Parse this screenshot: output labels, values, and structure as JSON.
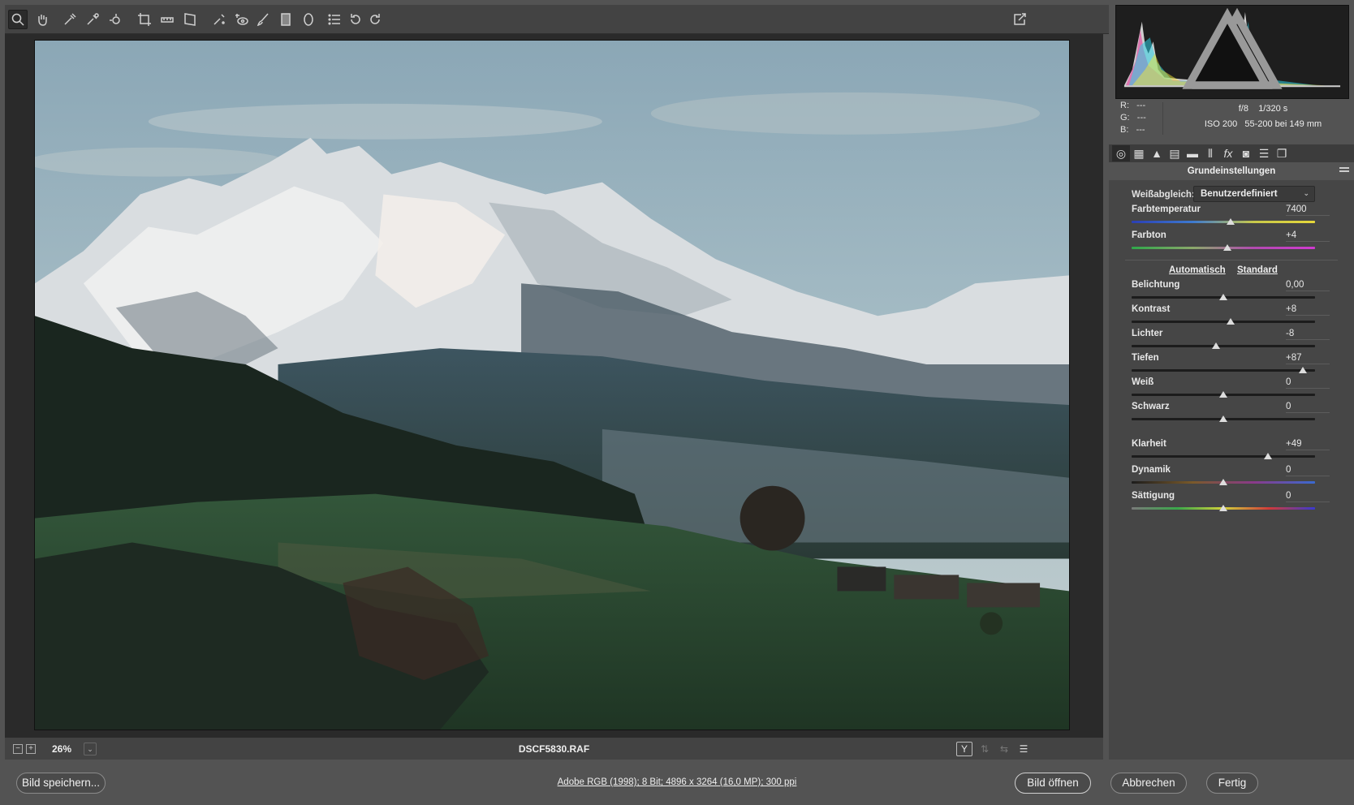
{
  "toolbar": {
    "tools": [
      "zoom-tool",
      "hand-tool",
      "white-balance-tool",
      "color-sampler-tool",
      "targeted-adjustment-tool",
      "crop-tool",
      "straighten-tool",
      "transform-tool",
      "spot-removal-tool",
      "red-eye-tool",
      "adjustment-brush-tool",
      "graduated-filter-tool",
      "radial-filter-tool",
      "preferences-tool",
      "rotate-left-tool",
      "rotate-right-tool"
    ]
  },
  "preview": {
    "zoom": "26%",
    "filename": "DSCF5830.RAF",
    "view_toggle": "Y"
  },
  "info": {
    "r_label": "R:",
    "r_value": "---",
    "g_label": "G:",
    "g_value": "---",
    "b_label": "B:",
    "b_value": "---",
    "aperture": "f/8",
    "shutter": "1/320 s",
    "iso": "ISO 200",
    "lens": "55-200 bei 149 mm"
  },
  "panel": {
    "title": "Grundeinstellungen",
    "wb_label": "Weißabgleich:",
    "wb_value": "Benutzerdefiniert",
    "auto_link": "Automatisch",
    "default_link": "Standard",
    "sliders": [
      {
        "label": "Farbtemperatur",
        "value": "7400",
        "pos": 0.54
      },
      {
        "label": "Farbton",
        "value": "+4",
        "pos": 0.52
      },
      {
        "label": "Belichtung",
        "value": "0,00",
        "pos": 0.5
      },
      {
        "label": "Kontrast",
        "value": "+8",
        "pos": 0.54
      },
      {
        "label": "Lichter",
        "value": "-8",
        "pos": 0.46
      },
      {
        "label": "Tiefen",
        "value": "+87",
        "pos": 0.935
      },
      {
        "label": "Weiß",
        "value": "0",
        "pos": 0.5
      },
      {
        "label": "Schwarz",
        "value": "0",
        "pos": 0.5
      },
      {
        "label": "Klarheit",
        "value": "+49",
        "pos": 0.745
      },
      {
        "label": "Dynamik",
        "value": "0",
        "pos": 0.5
      },
      {
        "label": "Sättigung",
        "value": "0",
        "pos": 0.5
      }
    ]
  },
  "footer": {
    "save_label": "Bild speichern...",
    "workflow": "Adobe RGB (1998); 8 Bit; 4896 x 3264 (16,0 MP); 300 ppi",
    "open_label": "Bild öffnen",
    "cancel_label": "Abbrechen",
    "done_label": "Fertig"
  },
  "colors": {
    "panel": "#535353",
    "preview_bg": "#2a2a2a",
    "toolbar": "#434343"
  }
}
